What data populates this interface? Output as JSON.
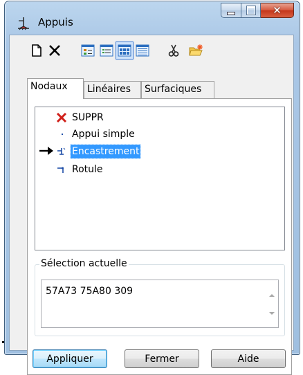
{
  "window": {
    "title": "Appuis"
  },
  "toolbar": {
    "buttons": [
      {
        "icon": "new-document-icon"
      },
      {
        "icon": "delete-x-icon"
      },
      {
        "icon": "view-small-icons-icon"
      },
      {
        "icon": "view-list-icon"
      },
      {
        "icon": "view-large-icons-icon",
        "pressed": true
      },
      {
        "icon": "view-details-icon"
      },
      {
        "icon": "scissors-icon"
      },
      {
        "icon": "open-folder-icon"
      }
    ]
  },
  "tabs": [
    {
      "label": "Nodaux",
      "active": true
    },
    {
      "label": "Linéaires",
      "active": false
    },
    {
      "label": "Surfaciques",
      "active": false
    }
  ],
  "supports": {
    "items": [
      {
        "label": "SUPPR",
        "icon": "red-x-icon"
      },
      {
        "label": "Appui simple",
        "icon": "simple-support-icon"
      },
      {
        "label": "Encastrement",
        "icon": "fixed-support-icon",
        "selected": true,
        "current": true
      },
      {
        "label": "Rotule",
        "icon": "hinge-icon"
      }
    ]
  },
  "selection": {
    "group_title": "Sélection actuelle",
    "value": "57A73 75A80 309"
  },
  "buttons": {
    "apply": "Appliquer",
    "close": "Fermer",
    "help": "Aide"
  },
  "colors": {
    "selection_highlight": "#3399ff",
    "close_button": "#c4371b",
    "delete_red": "#d0201a",
    "support_icon_blue": "#1f4fa8"
  }
}
